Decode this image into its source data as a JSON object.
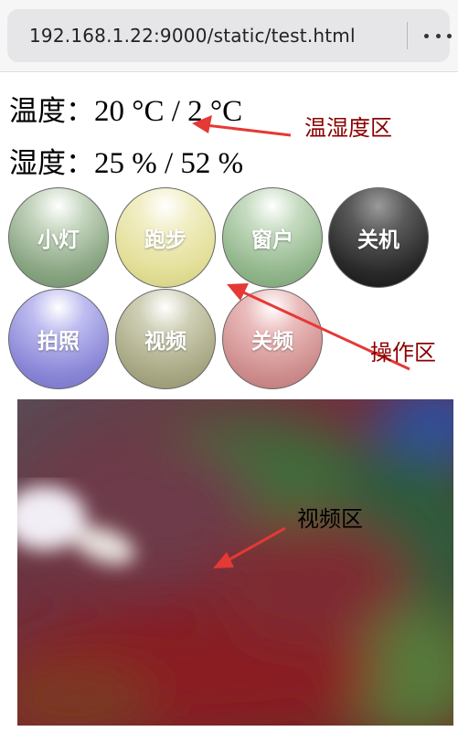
{
  "browser": {
    "url": "192.168.1.22:9000/static/test.html"
  },
  "sensors": {
    "temperature_label": "温度：",
    "temperature_value": "20 °C / 2 °C",
    "humidity_label": "湿度：",
    "humidity_value": "25 % / 52 %"
  },
  "controls": {
    "buttons": [
      {
        "label": "小灯",
        "color": "#8aa683"
      },
      {
        "label": "跑步",
        "color": "#e3df98"
      },
      {
        "label": "窗户",
        "color": "#93b78d"
      },
      {
        "label": "关机",
        "color": "#2a2a2a"
      },
      {
        "label": "拍照",
        "color": "#8c88d8"
      },
      {
        "label": "视频",
        "color": "#a9a985"
      },
      {
        "label": "关频",
        "color": "#d08f8f"
      }
    ]
  },
  "annotations": {
    "sensor_area": "温湿度区",
    "control_area": "操作区",
    "video_area": "视频区",
    "annotation_color": "#8b0000",
    "arrow_color": "#e53935"
  }
}
